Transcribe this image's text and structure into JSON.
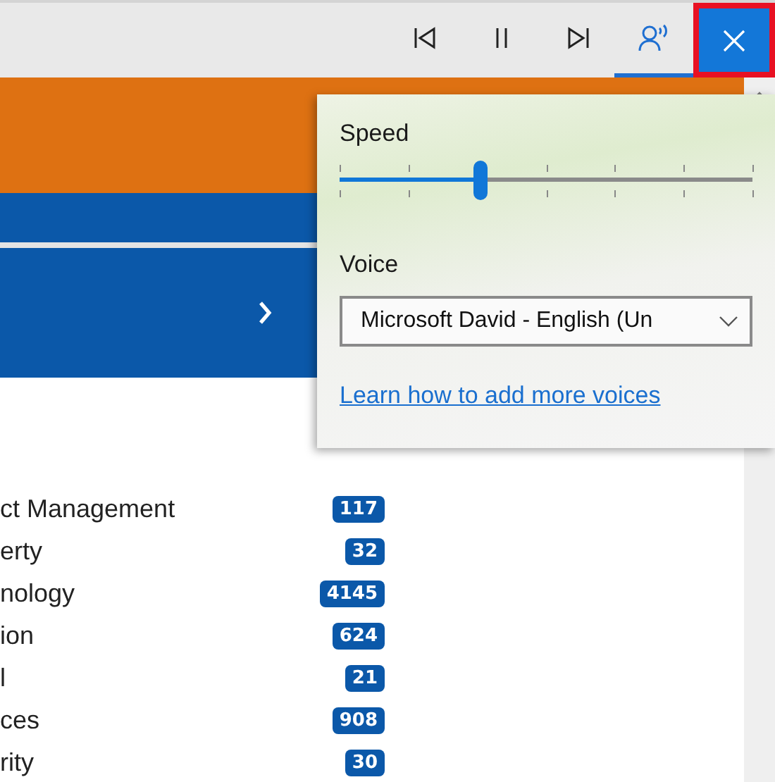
{
  "toolbar": {
    "buttons": [
      {
        "kind": "previous"
      },
      {
        "kind": "pause"
      },
      {
        "kind": "next"
      },
      {
        "kind": "voice",
        "selected": true
      }
    ],
    "close": {
      "kind": "close"
    }
  },
  "flyout": {
    "speed_label": "Speed",
    "speed": {
      "level": 0.34
    },
    "voice_label": "Voice",
    "voice": {
      "value": "Microsoft David - English (Un"
    },
    "link": "Learn how to add more voices"
  },
  "list": [
    {
      "label": "ct Management",
      "count": "117"
    },
    {
      "label": "erty",
      "count": "32"
    },
    {
      "label": "nology",
      "count": "4145"
    },
    {
      "label": "ion",
      "count": "624"
    },
    {
      "label": "l",
      "count": "21"
    },
    {
      "label": "ces",
      "count": "908"
    },
    {
      "label": "rity",
      "count": "30"
    }
  ]
}
